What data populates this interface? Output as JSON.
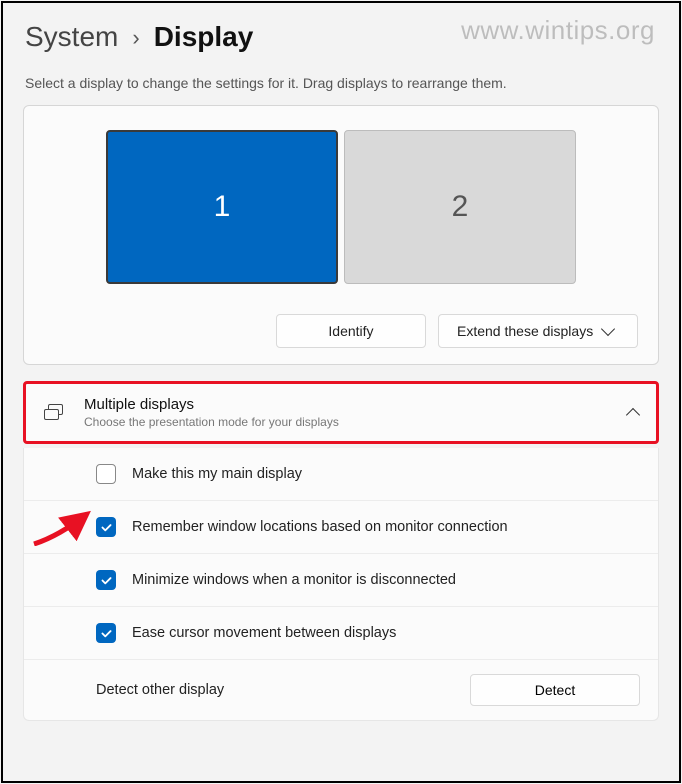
{
  "watermark": "www.wintips.org",
  "breadcrumb": {
    "root": "System",
    "current": "Display"
  },
  "hint": "Select a display to change the settings for it. Drag displays to rearrange them.",
  "monitors": [
    {
      "id": "1",
      "active": true
    },
    {
      "id": "2",
      "active": false
    }
  ],
  "buttons": {
    "identify": "Identify",
    "extend": "Extend these displays"
  },
  "section": {
    "title": "Multiple displays",
    "subtitle": "Choose the presentation mode for your displays"
  },
  "options": {
    "main_display": "Make this my main display",
    "remember_locations": "Remember window locations based on monitor connection",
    "minimize_disconnect": "Minimize windows when a monitor is disconnected",
    "ease_cursor": "Ease cursor movement between displays"
  },
  "detect": {
    "label": "Detect other display",
    "button": "Detect"
  }
}
